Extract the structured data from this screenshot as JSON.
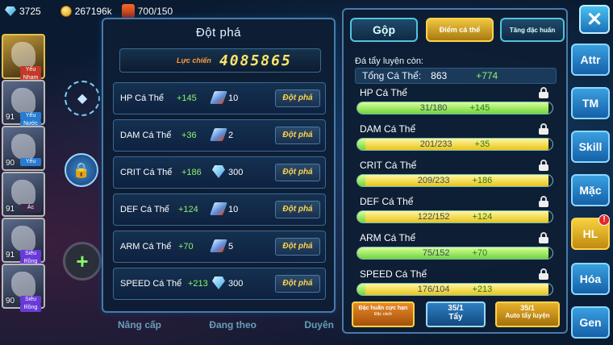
{
  "topbar": {
    "diamonds": "3725",
    "gold": "267196k",
    "energy": "700/150"
  },
  "left": {
    "cards": [
      {
        "level": "",
        "tag": "Yếu",
        "tag2": "Nham",
        "style": "gold",
        "type": "fire"
      },
      {
        "level": "91",
        "tag": "Yếu",
        "tag2": "Nước",
        "style": "",
        "type": ""
      },
      {
        "level": "90",
        "tag": "Yếu",
        "tag2": "",
        "style": "",
        "type": ""
      },
      {
        "level": "91",
        "tag": "Ác",
        "tag2": "",
        "style": "",
        "type": "dark"
      },
      {
        "level": "91",
        "tag": "Siêu",
        "tag2": "Rồng",
        "style": "",
        "type": "dragon"
      },
      {
        "level": "90",
        "tag": "Siêu",
        "tag2": "Rồng",
        "style": "",
        "type": "dragon"
      }
    ],
    "bottom_tabs": [
      "Nâng cấp",
      "Đang theo",
      "Duyên"
    ]
  },
  "breakthrough": {
    "title": "Đột phá",
    "power_label": "Lực chiến",
    "power_value": "4085865",
    "rows": [
      {
        "name": "HP Cá Thể",
        "bonus": "+145",
        "cost": "10",
        "cost_icon": "scroll-icon",
        "btn": "Đột phá"
      },
      {
        "name": "DAM Cá Thể",
        "bonus": "+36",
        "cost": "2",
        "cost_icon": "scroll-icon",
        "btn": "Đột phá"
      },
      {
        "name": "CRIT Cá Thể",
        "bonus": "+186",
        "cost": "300",
        "cost_icon": "gem-icon",
        "btn": "Đột phá"
      },
      {
        "name": "DEF Cá Thể",
        "bonus": "+124",
        "cost": "10",
        "cost_icon": "scroll-icon",
        "btn": "Đột phá"
      },
      {
        "name": "ARM Cá Thể",
        "bonus": "+70",
        "cost": "5",
        "cost_icon": "scroll-icon",
        "btn": "Đột phá"
      },
      {
        "name": "SPEED Cá Thể",
        "bonus": "+213",
        "cost": "300",
        "cost_icon": "gem-icon",
        "btn": "Đột phá"
      }
    ]
  },
  "training": {
    "tabs": {
      "merge": "Gộp",
      "individual": "Điểm cá thể",
      "special": "Tăng đặc huấn"
    },
    "remaining_label": "Đá tẩy luyện còn:",
    "total_label": "Tổng Cá Thể:",
    "total_value": "863",
    "total_bonus": "+774",
    "stats": [
      {
        "name": "HP Cá Thể",
        "value": "31/180",
        "bonus": "+145",
        "fill": 0.98,
        "kind": "green"
      },
      {
        "name": "DAM Cá Thể",
        "value": "201/233",
        "bonus": "+35",
        "fill": 0.98,
        "kind": "yellow"
      },
      {
        "name": "CRIT Cá Thể",
        "value": "209/233",
        "bonus": "+186",
        "fill": 0.98,
        "kind": "yellow"
      },
      {
        "name": "DEF Cá Thể",
        "value": "122/152",
        "bonus": "+124",
        "fill": 0.98,
        "kind": "yellow"
      },
      {
        "name": "ARM Cá Thể",
        "value": "75/152",
        "bonus": "+70",
        "fill": 0.98,
        "kind": "green"
      },
      {
        "name": "SPEED Cá Thể",
        "value": "176/104",
        "bonus": "+213",
        "fill": 0.98,
        "kind": "yellow"
      }
    ],
    "buttons": {
      "special_label": "Đặc huấn cực hạn",
      "special_sub": "Đặc cách",
      "wash_count": "35/1",
      "wash_label": "Tẩy",
      "auto_count": "35/1",
      "auto_label": "Auto tẩy luyện"
    }
  },
  "side": {
    "close": "✕",
    "attr": "Attr",
    "tm": "TM",
    "skill": "Skill",
    "mac": "Mặc",
    "hl": "HL",
    "hoa": "Hóa",
    "gen": "Gen",
    "hl_badge": "!"
  }
}
